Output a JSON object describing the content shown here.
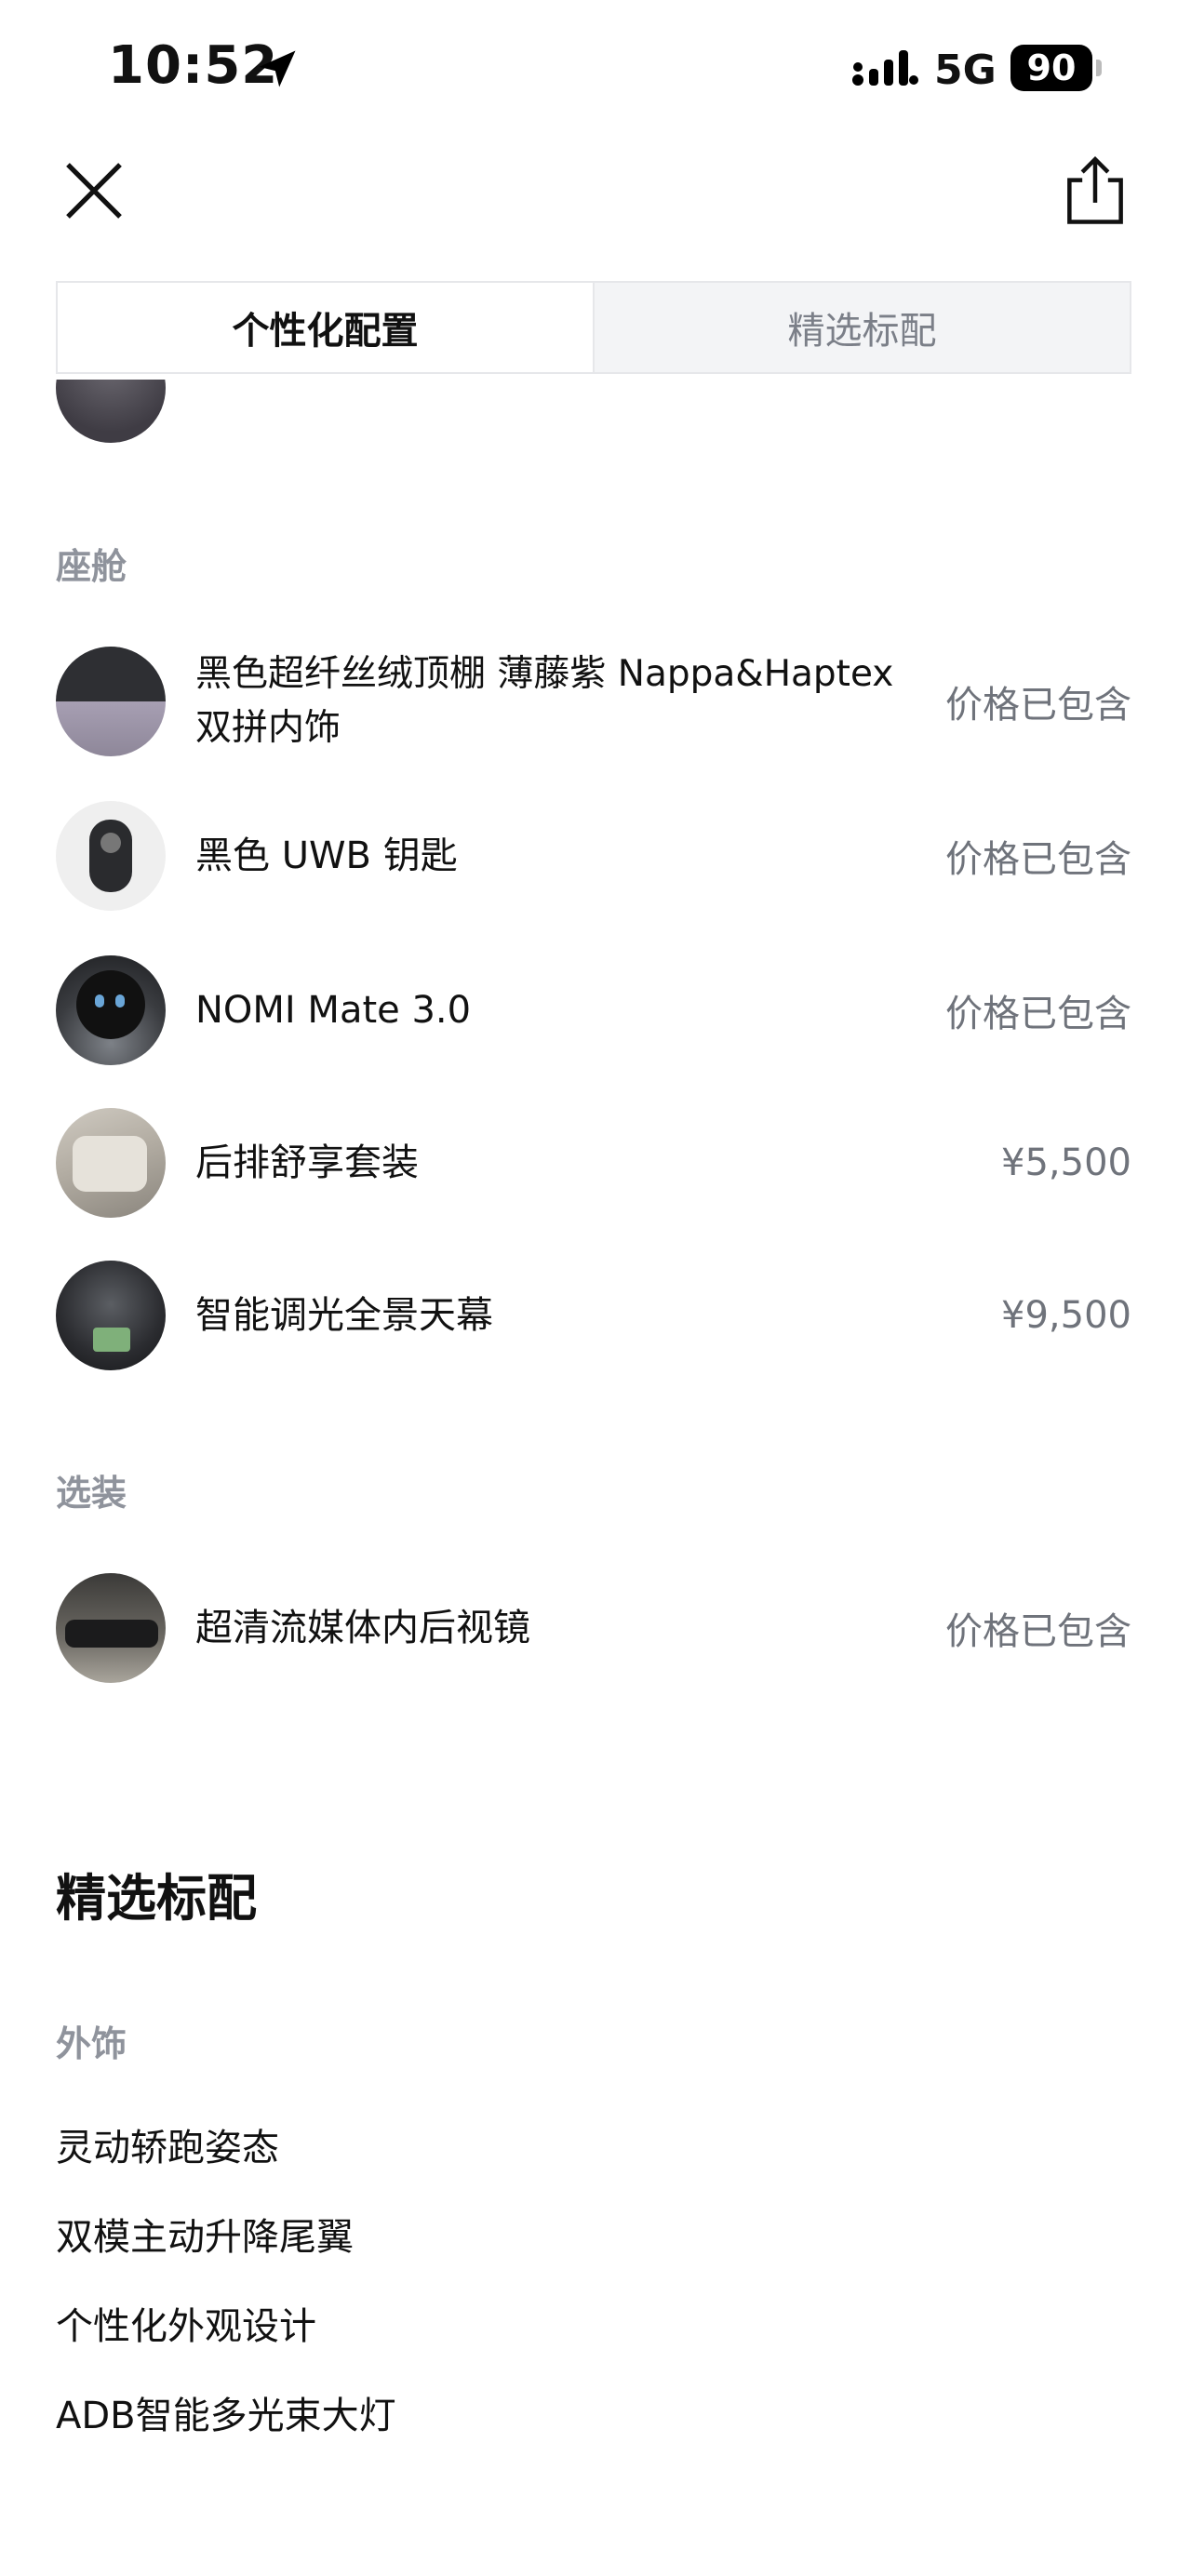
{
  "status_bar": {
    "time": "10:52",
    "network": "5G",
    "battery": "90"
  },
  "tabs": [
    "个性化配置",
    "精选标配"
  ],
  "sections": {
    "cabin": "座舱",
    "optional": "选装"
  },
  "cabin_items": [
    {
      "name": "黑色超纤丝绒顶棚 薄藤紫 Nappa&Haptex 双拼内饰",
      "price": "价格已包含"
    },
    {
      "name": "黑色 UWB 钥匙",
      "price": "价格已包含"
    },
    {
      "name": "NOMI Mate 3.0",
      "price": "价格已包含"
    },
    {
      "name": "后排舒享套装",
      "price": "¥5,500"
    },
    {
      "name": "智能调光全景天幕",
      "price": "¥9,500"
    }
  ],
  "optional_items": [
    {
      "name": "超清流媒体内后视镜",
      "price": "价格已包含"
    }
  ],
  "standard": {
    "title": "精选标配",
    "exterior_label": "外饰",
    "items": [
      "灵动轿跑姿态",
      "双模主动升降尾翼",
      "个性化外观设计",
      "ADB智能多光束大灯"
    ]
  },
  "icons": [
    "location-arrow-icon",
    "signal-icon",
    "close-icon",
    "share-icon"
  ]
}
